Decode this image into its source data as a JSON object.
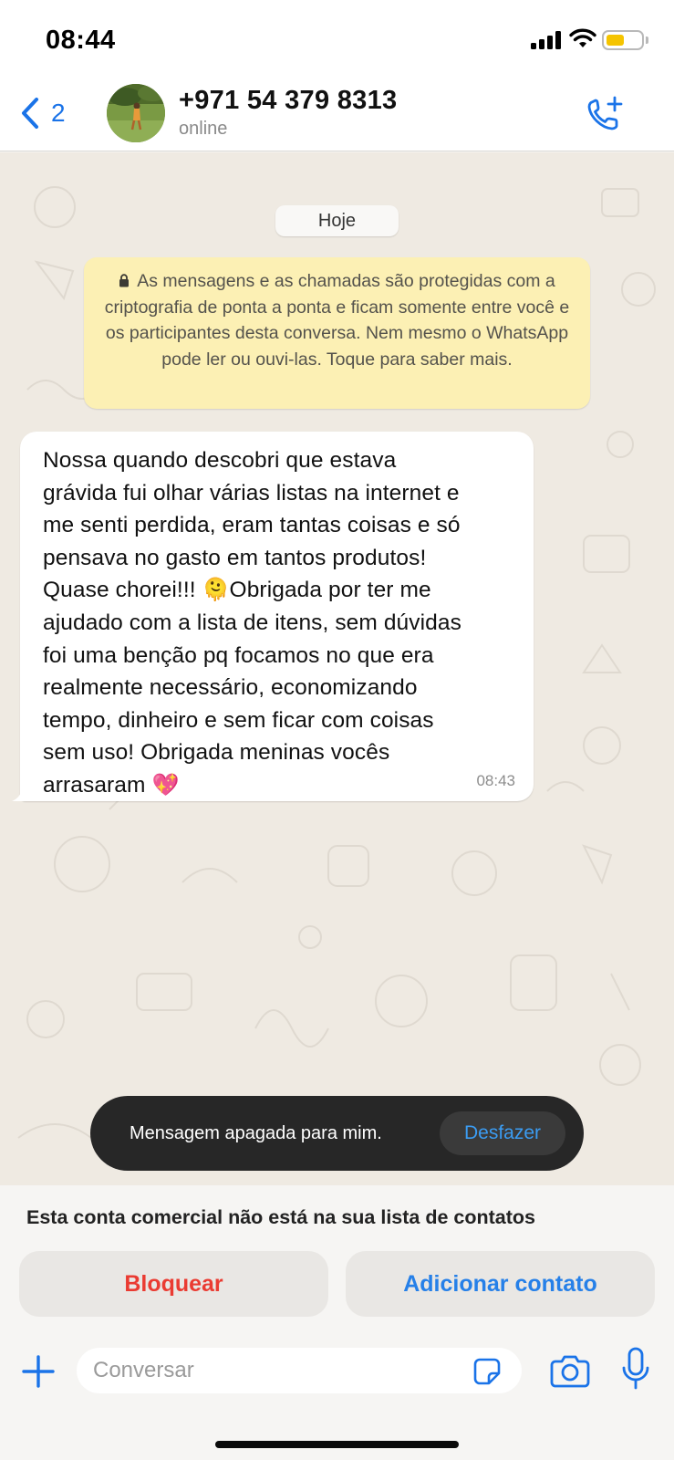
{
  "status_bar": {
    "time": "08:44"
  },
  "header": {
    "back_count": "2",
    "contact_name": "+971 54 379 8313",
    "contact_status": "online"
  },
  "chat": {
    "date_label": "Hoje",
    "encryption_notice": "As mensagens e as chamadas são protegidas com a criptografia de ponta a ponta e ficam somente entre você e os participantes desta conversa. Nem mesmo o WhatsApp pode ler ou ouvi-las. Toque para saber mais.",
    "message": {
      "text_part1": "Nossa quando descobri que estava\ngrávida fui olhar várias listas na internet e\nme senti perdida, eram tantas coisas e só\npensava no gasto em tantos produtos!\nQuase chorei!!! ",
      "emoji1": "🫠",
      "text_part2": "Obrigada por ter me\najudado com a lista de itens, sem dúvidas\nfoi uma benção pq focamos no que era\nrealmente necessário, economizando\ntempo, dinheiro e sem ficar com coisas\nsem uso! Obrigada meninas vocês\narrasaram ",
      "emoji2": "💖",
      "time": "08:43"
    }
  },
  "toast": {
    "text": "Mensagem apagada para mim.",
    "action": "Desfazer"
  },
  "business_notice": {
    "text": "Esta conta comercial não está na sua lista de contatos",
    "block_label": "Bloquear",
    "add_label": "Adicionar contato"
  },
  "composer": {
    "placeholder": "Conversar"
  },
  "colors": {
    "accent": "#1a73e8",
    "danger": "#ea3b32",
    "notice_bg": "#fcf0b4",
    "chat_bg": "#efeae2"
  },
  "icons": [
    "chevron-left-icon",
    "add-call-icon",
    "lock-icon",
    "plus-icon",
    "sticker-icon",
    "camera-icon",
    "mic-icon"
  ]
}
